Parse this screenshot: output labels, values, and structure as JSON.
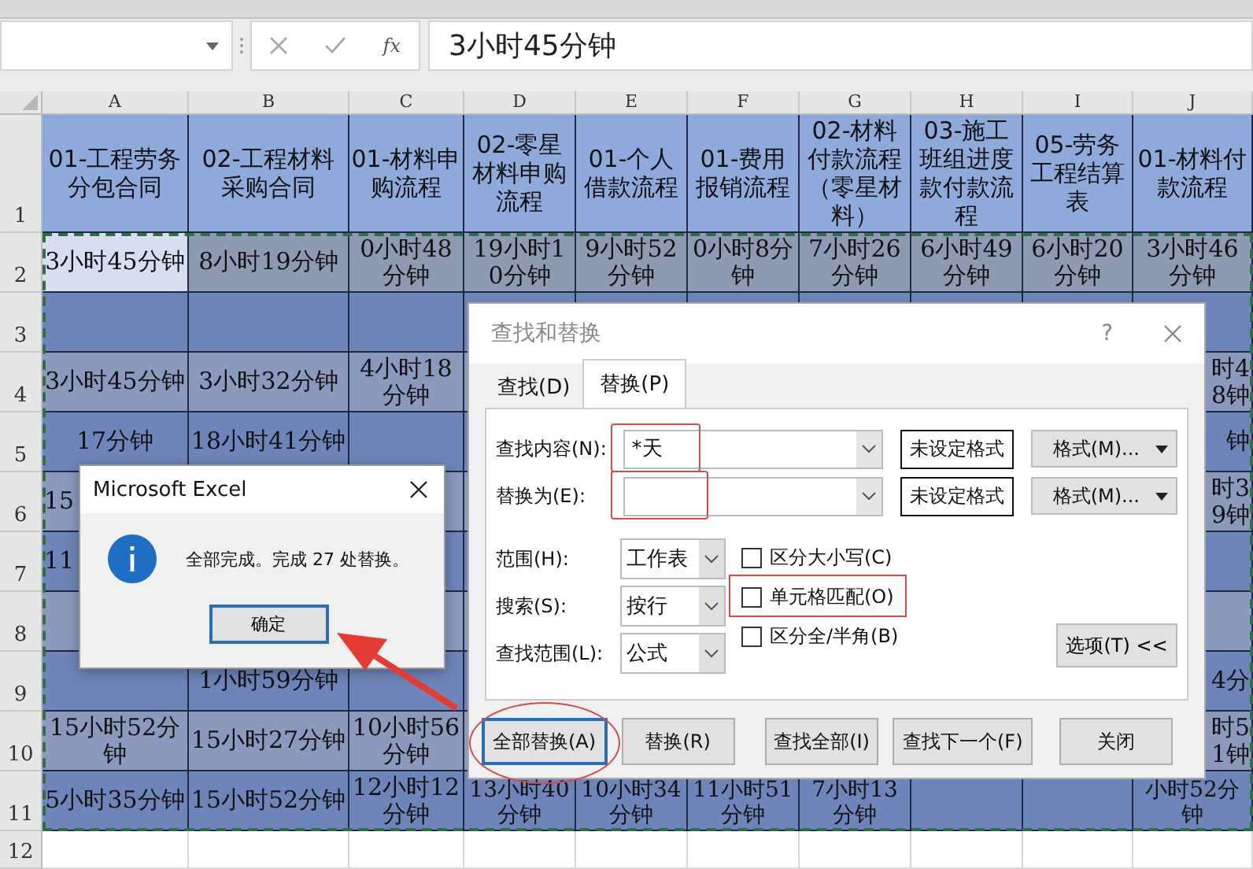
{
  "formula_bar": {
    "function_label": "fx",
    "formula": "3小时45分钟"
  },
  "columns": [
    "A",
    "B",
    "C",
    "D",
    "E",
    "F",
    "G",
    "H",
    "I",
    "J"
  ],
  "rows": [
    {
      "number": "1",
      "cells": [
        "01-工程劳务分包合同",
        "02-工程材料采购合同",
        "01-材料申购流程",
        "02-零星材料申购流程",
        "01-个人借款流程",
        "01-费用报销流程",
        "02-材料付款流程（零星材料）",
        "03-施工班组进度款付款流程",
        "05-劳务工程结算表",
        "01-材料付款流程"
      ]
    },
    {
      "number": "2",
      "cells": [
        "3小时45分钟",
        "8小时19分钟",
        "0小时48分钟",
        "19小时10分钟",
        "9小时52分钟",
        "0小时8分钟",
        "7小时26分钟",
        "6小时49分钟",
        "6小时20分钟",
        "3小时46分钟"
      ]
    },
    {
      "number": "3",
      "cells": [
        null,
        null,
        null,
        null,
        null,
        null,
        null,
        null,
        null,
        null
      ]
    },
    {
      "number": "4",
      "cells": [
        "3小时45分钟",
        "3小时32分钟",
        "4小时18分钟",
        null,
        null,
        null,
        null,
        null,
        null,
        "时48钟"
      ]
    },
    {
      "number": "5",
      "cells": [
        "17分钟",
        "18小时41分钟",
        null,
        null,
        null,
        null,
        null,
        null,
        null,
        "钟"
      ]
    },
    {
      "number": "6",
      "cells": [
        "15",
        null,
        null,
        null,
        null,
        null,
        null,
        null,
        null,
        "时39钟"
      ]
    },
    {
      "number": "7",
      "cells": [
        "11",
        null,
        null,
        null,
        null,
        null,
        null,
        null,
        null,
        null
      ]
    },
    {
      "number": "8",
      "cells": [
        null,
        null,
        null,
        null,
        null,
        null,
        null,
        null,
        null,
        null
      ]
    },
    {
      "number": "9",
      "cells": [
        null,
        "1小时59分钟",
        null,
        null,
        null,
        null,
        null,
        null,
        null,
        "4分"
      ]
    },
    {
      "number": "10",
      "cells": [
        "15小时52分钟",
        "15小时27分钟",
        "10小时56分钟",
        null,
        null,
        null,
        null,
        null,
        null,
        "时51钟"
      ]
    },
    {
      "number": "11",
      "cells": [
        "5小时35分钟",
        "15小时52分钟",
        "12小时12分钟",
        "13小时40分钟",
        "10小时34分钟",
        "11小时51分钟",
        "7小时13分钟",
        null,
        null,
        "小时52分钟"
      ]
    },
    {
      "number": "12",
      "cells": []
    }
  ],
  "find_replace_dialog": {
    "title": "查找和替换",
    "help": "?",
    "tabs": [
      {
        "label": "查找(D)",
        "selected": false
      },
      {
        "label": "替换(P)",
        "selected": true
      }
    ],
    "fields": [
      {
        "label": "查找内容(N):",
        "value": "*天",
        "format_status": "未设定格式",
        "format_button": "格式(M)...",
        "highlighted": true
      },
      {
        "label": "替换为(E):",
        "format_status": "未设定格式",
        "format_button": "格式(M)...",
        "highlighted": true
      }
    ],
    "options": [
      {
        "label": "范围(H):",
        "value": "工作表"
      },
      {
        "label": "搜索(S):",
        "value": "按行"
      },
      {
        "label": "查找范围(L):",
        "value": "公式"
      }
    ],
    "checkboxes": [
      {
        "label": "区分大小写(C)",
        "checked": false,
        "highlighted": false
      },
      {
        "label": "单元格匹配(O)",
        "checked": false,
        "highlighted": true
      },
      {
        "label": "区分全/半角(B)",
        "checked": false,
        "highlighted": false
      }
    ],
    "options_button": "选项(T) <<",
    "buttons": [
      {
        "label": "全部替换(A)",
        "focused": true,
        "circled": true
      },
      {
        "label": "替换(R)",
        "focused": false,
        "circled": false
      },
      {
        "label": "查找全部(I)",
        "focused": false,
        "circled": false
      },
      {
        "label": "查找下一个(F)",
        "focused": false,
        "circled": false
      },
      {
        "label": "关闭",
        "focused": false,
        "circled": false
      }
    ]
  },
  "message_box": {
    "title": "Microsoft Excel",
    "message": "全部完成。完成 27 处替换。",
    "button": "确定"
  }
}
